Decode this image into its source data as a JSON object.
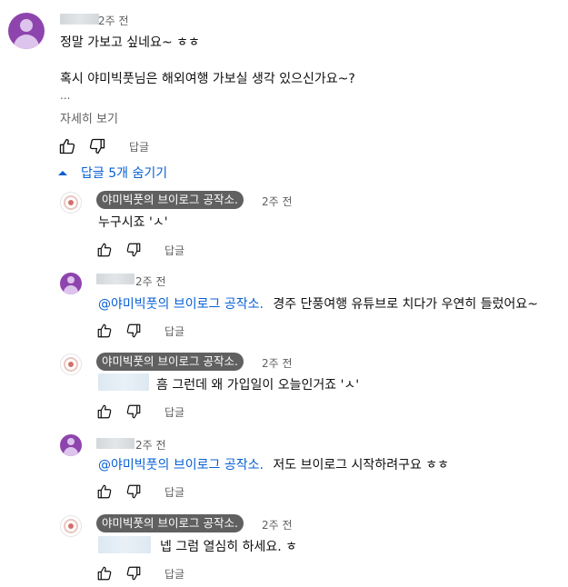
{
  "top_comment": {
    "time": "2주 전",
    "line1": "정말 가보고 싶네요~ ㅎㅎ",
    "line2": "혹시 야미빅풋님은 해외여행 가보실 생각 있으신가요~?",
    "ellipsis": "...",
    "read_more": "자세히 보기",
    "reply_label": "답글"
  },
  "replies_toggle": {
    "label": "답글 5개 숨기기"
  },
  "replies": [
    {
      "author": "야미빅풋의 브이로그 공작소.",
      "time": "2주 전",
      "mention": "",
      "text": "누구시죠 'ㅅ'",
      "reply_label": "답글",
      "avatar": "channel-logo"
    },
    {
      "author": "",
      "time": "2주 전",
      "mention": "@야미빅풋의 브이로그 공작소.",
      "text": "경주 단풍여행 유튜브로 치다가 우연히 들렀어요~",
      "reply_label": "답글",
      "avatar": "user-avatar"
    },
    {
      "author": "야미빅풋의 브이로그 공작소.",
      "time": "2주 전",
      "mention": "",
      "text": "흠 그런데 왜 가입일이 오늘인거죠 'ㅅ'",
      "reply_label": "답글",
      "avatar": "channel-logo"
    },
    {
      "author": "",
      "time": "2주 전",
      "mention": "@야미빅풋의 브이로그 공작소.",
      "text": "저도 브이로그 시작하려구요 ㅎㅎ",
      "reply_label": "답글",
      "avatar": "user-avatar"
    },
    {
      "author": "야미빅풋의 브이로그 공작소.",
      "time": "2주 전",
      "mention": "",
      "text": "넵 그럼 열심히 하세요. ㅎ",
      "reply_label": "답글",
      "avatar": "channel-logo"
    }
  ],
  "icons": {
    "like": "thumbs-up-icon",
    "dislike": "thumbs-down-icon",
    "collapse": "caret-up-icon"
  },
  "colors": {
    "link": "#065fd4",
    "secondary_text": "#606060",
    "chip_bg": "#606060",
    "avatar": "#8e44ad"
  }
}
